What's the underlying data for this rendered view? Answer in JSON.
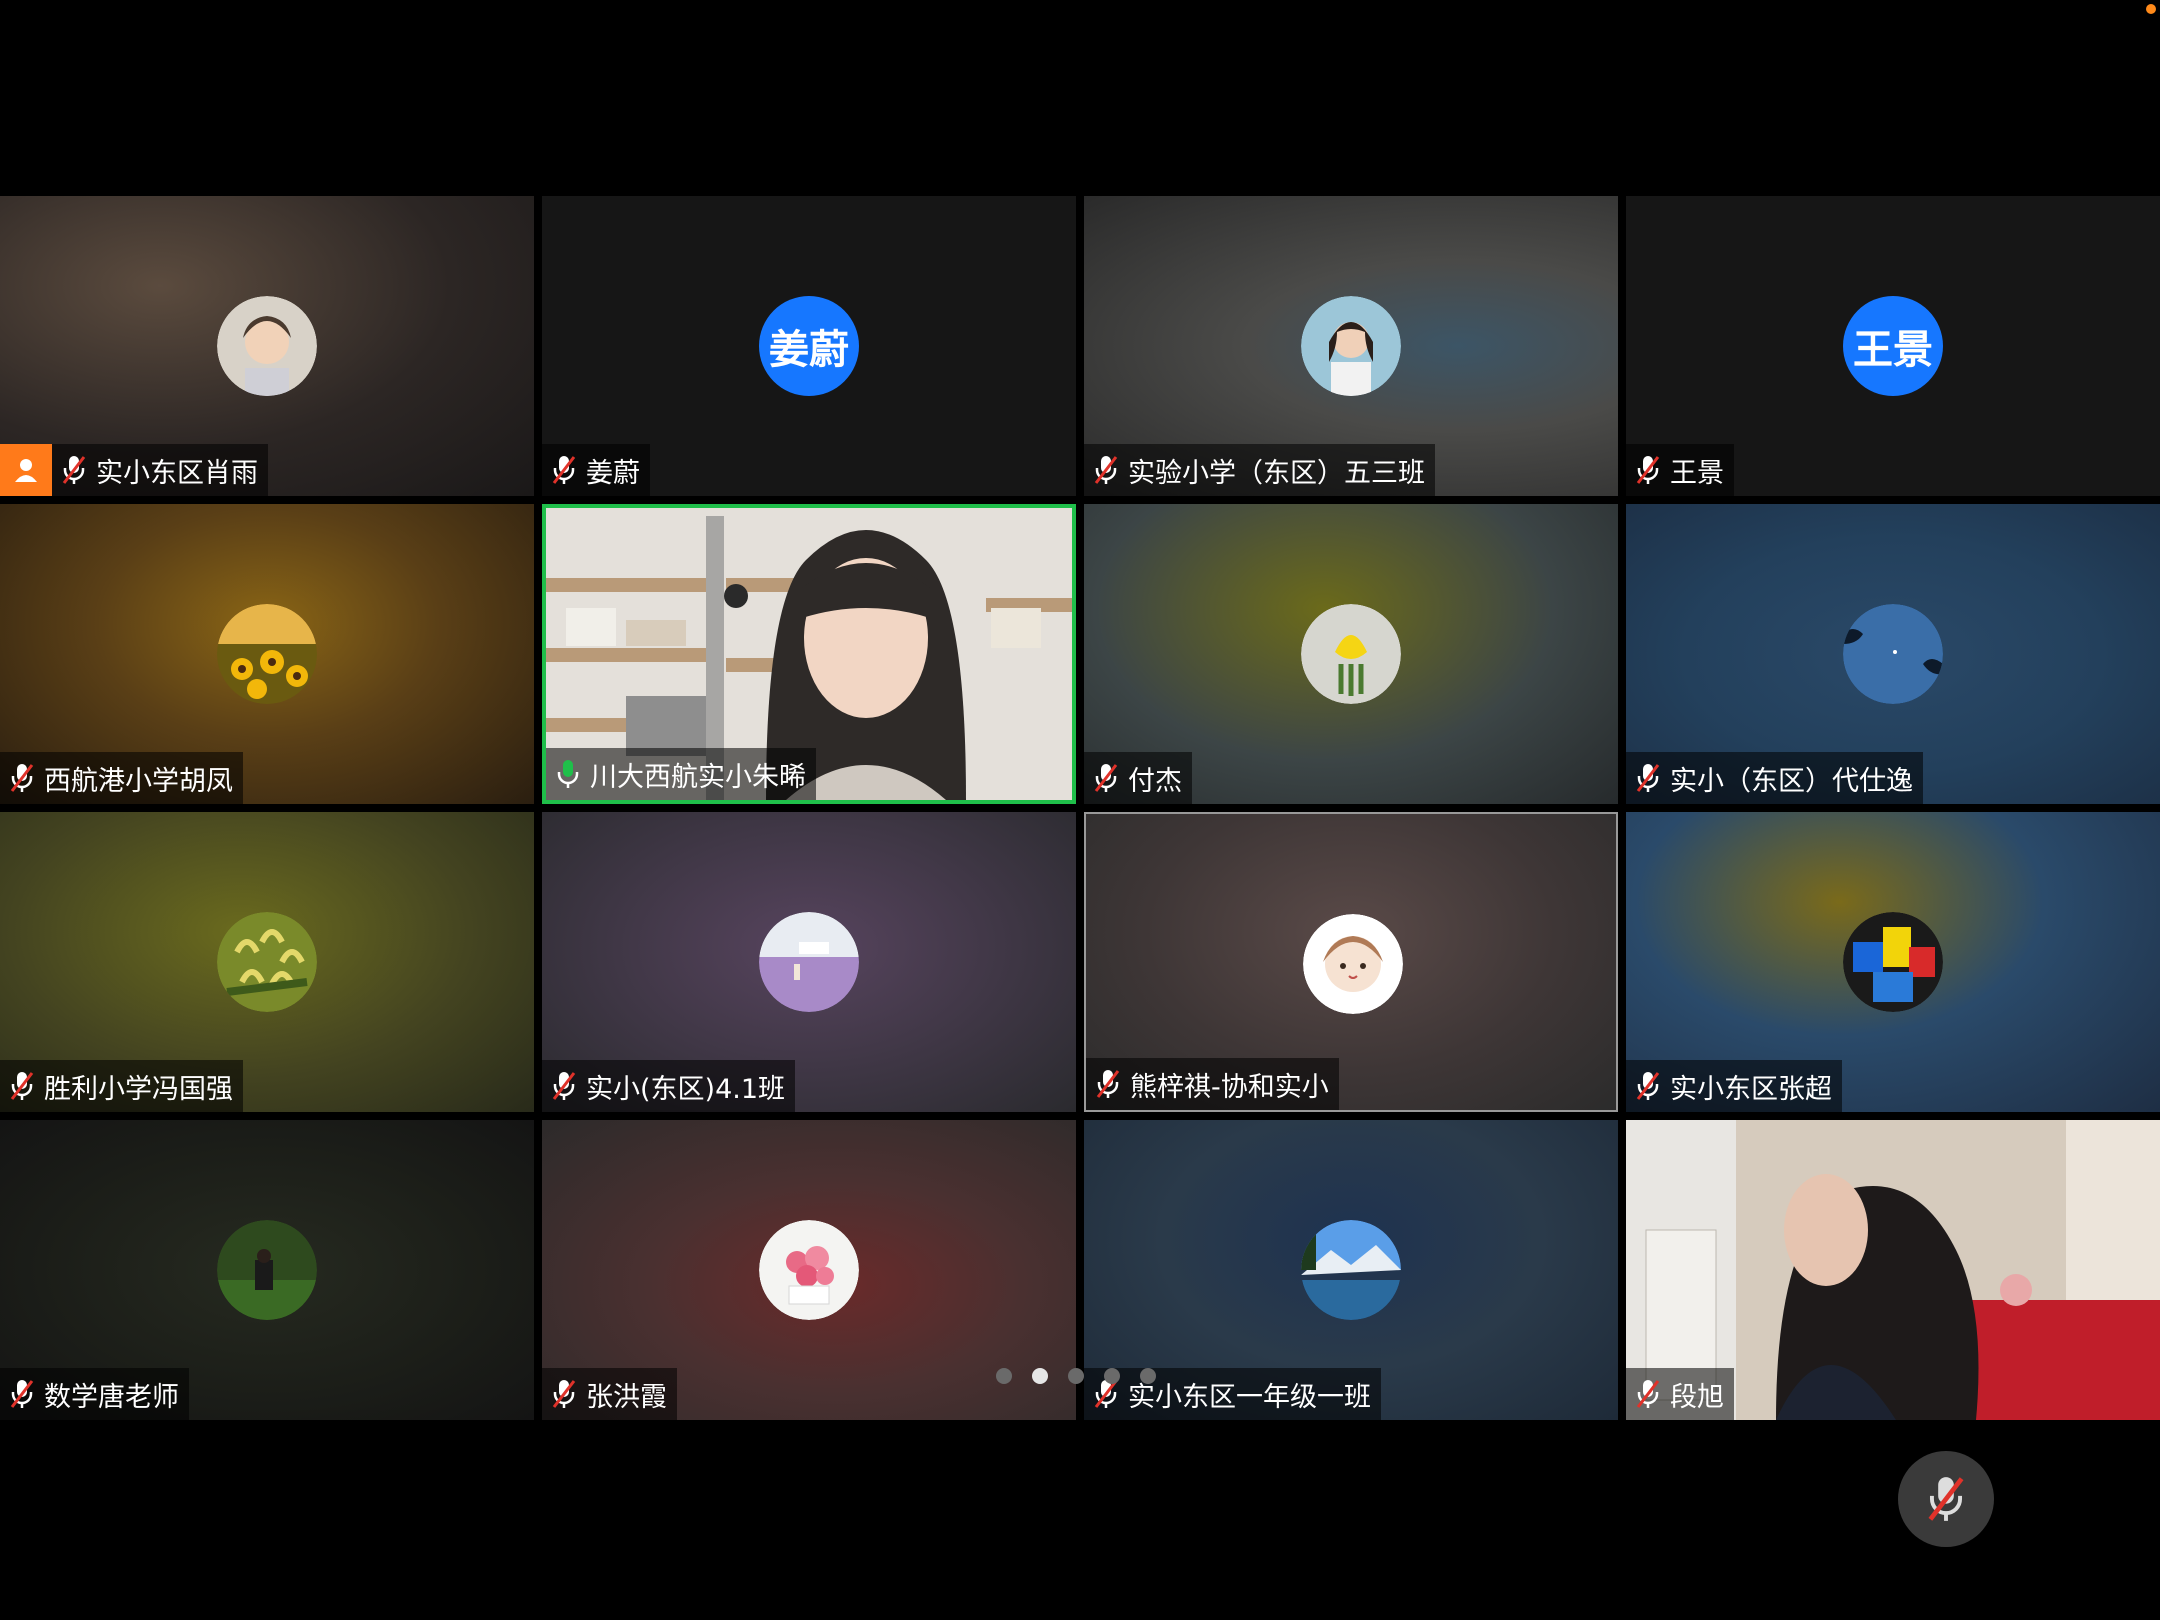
{
  "participants": [
    {
      "name": "实小东区肖雨",
      "avatar_type": "photo",
      "host": true
    },
    {
      "name": "姜蔚",
      "avatar_type": "text",
      "avatar_text": "姜蔚"
    },
    {
      "name": "实验小学（东区）五三班",
      "avatar_type": "photo"
    },
    {
      "name": "王景",
      "avatar_type": "text",
      "avatar_text": "王景"
    },
    {
      "name": "西航港小学胡凤",
      "avatar_type": "photo"
    },
    {
      "name": "川大西航实小朱晞",
      "avatar_type": "video",
      "speaking": true
    },
    {
      "name": "付杰",
      "avatar_type": "photo"
    },
    {
      "name": "实小（东区）代仕逸",
      "avatar_type": "photo"
    },
    {
      "name": "胜利小学冯国强",
      "avatar_type": "photo"
    },
    {
      "name": "实小(东区)4.1班",
      "avatar_type": "photo"
    },
    {
      "name": "熊梓祺-协和实小",
      "avatar_type": "photo"
    },
    {
      "name": "实小东区张超",
      "avatar_type": "photo"
    },
    {
      "name": "数学唐老师",
      "avatar_type": "photo"
    },
    {
      "name": "张洪霞",
      "avatar_type": "photo"
    },
    {
      "name": "实小东区一年级一班",
      "avatar_type": "photo"
    },
    {
      "name": "段旭",
      "avatar_type": "video"
    }
  ],
  "pagination": {
    "total_pages": 5,
    "current_page": 2
  },
  "colors": {
    "accent_blue": "#1677ff",
    "speaking_green": "#1fbf4a",
    "host_orange": "#ff7a1a",
    "muted_red": "#e0322a"
  },
  "icons": {
    "mic_muted": "mic-muted-icon",
    "mic_active": "mic-active-icon",
    "host": "host-person-icon"
  }
}
